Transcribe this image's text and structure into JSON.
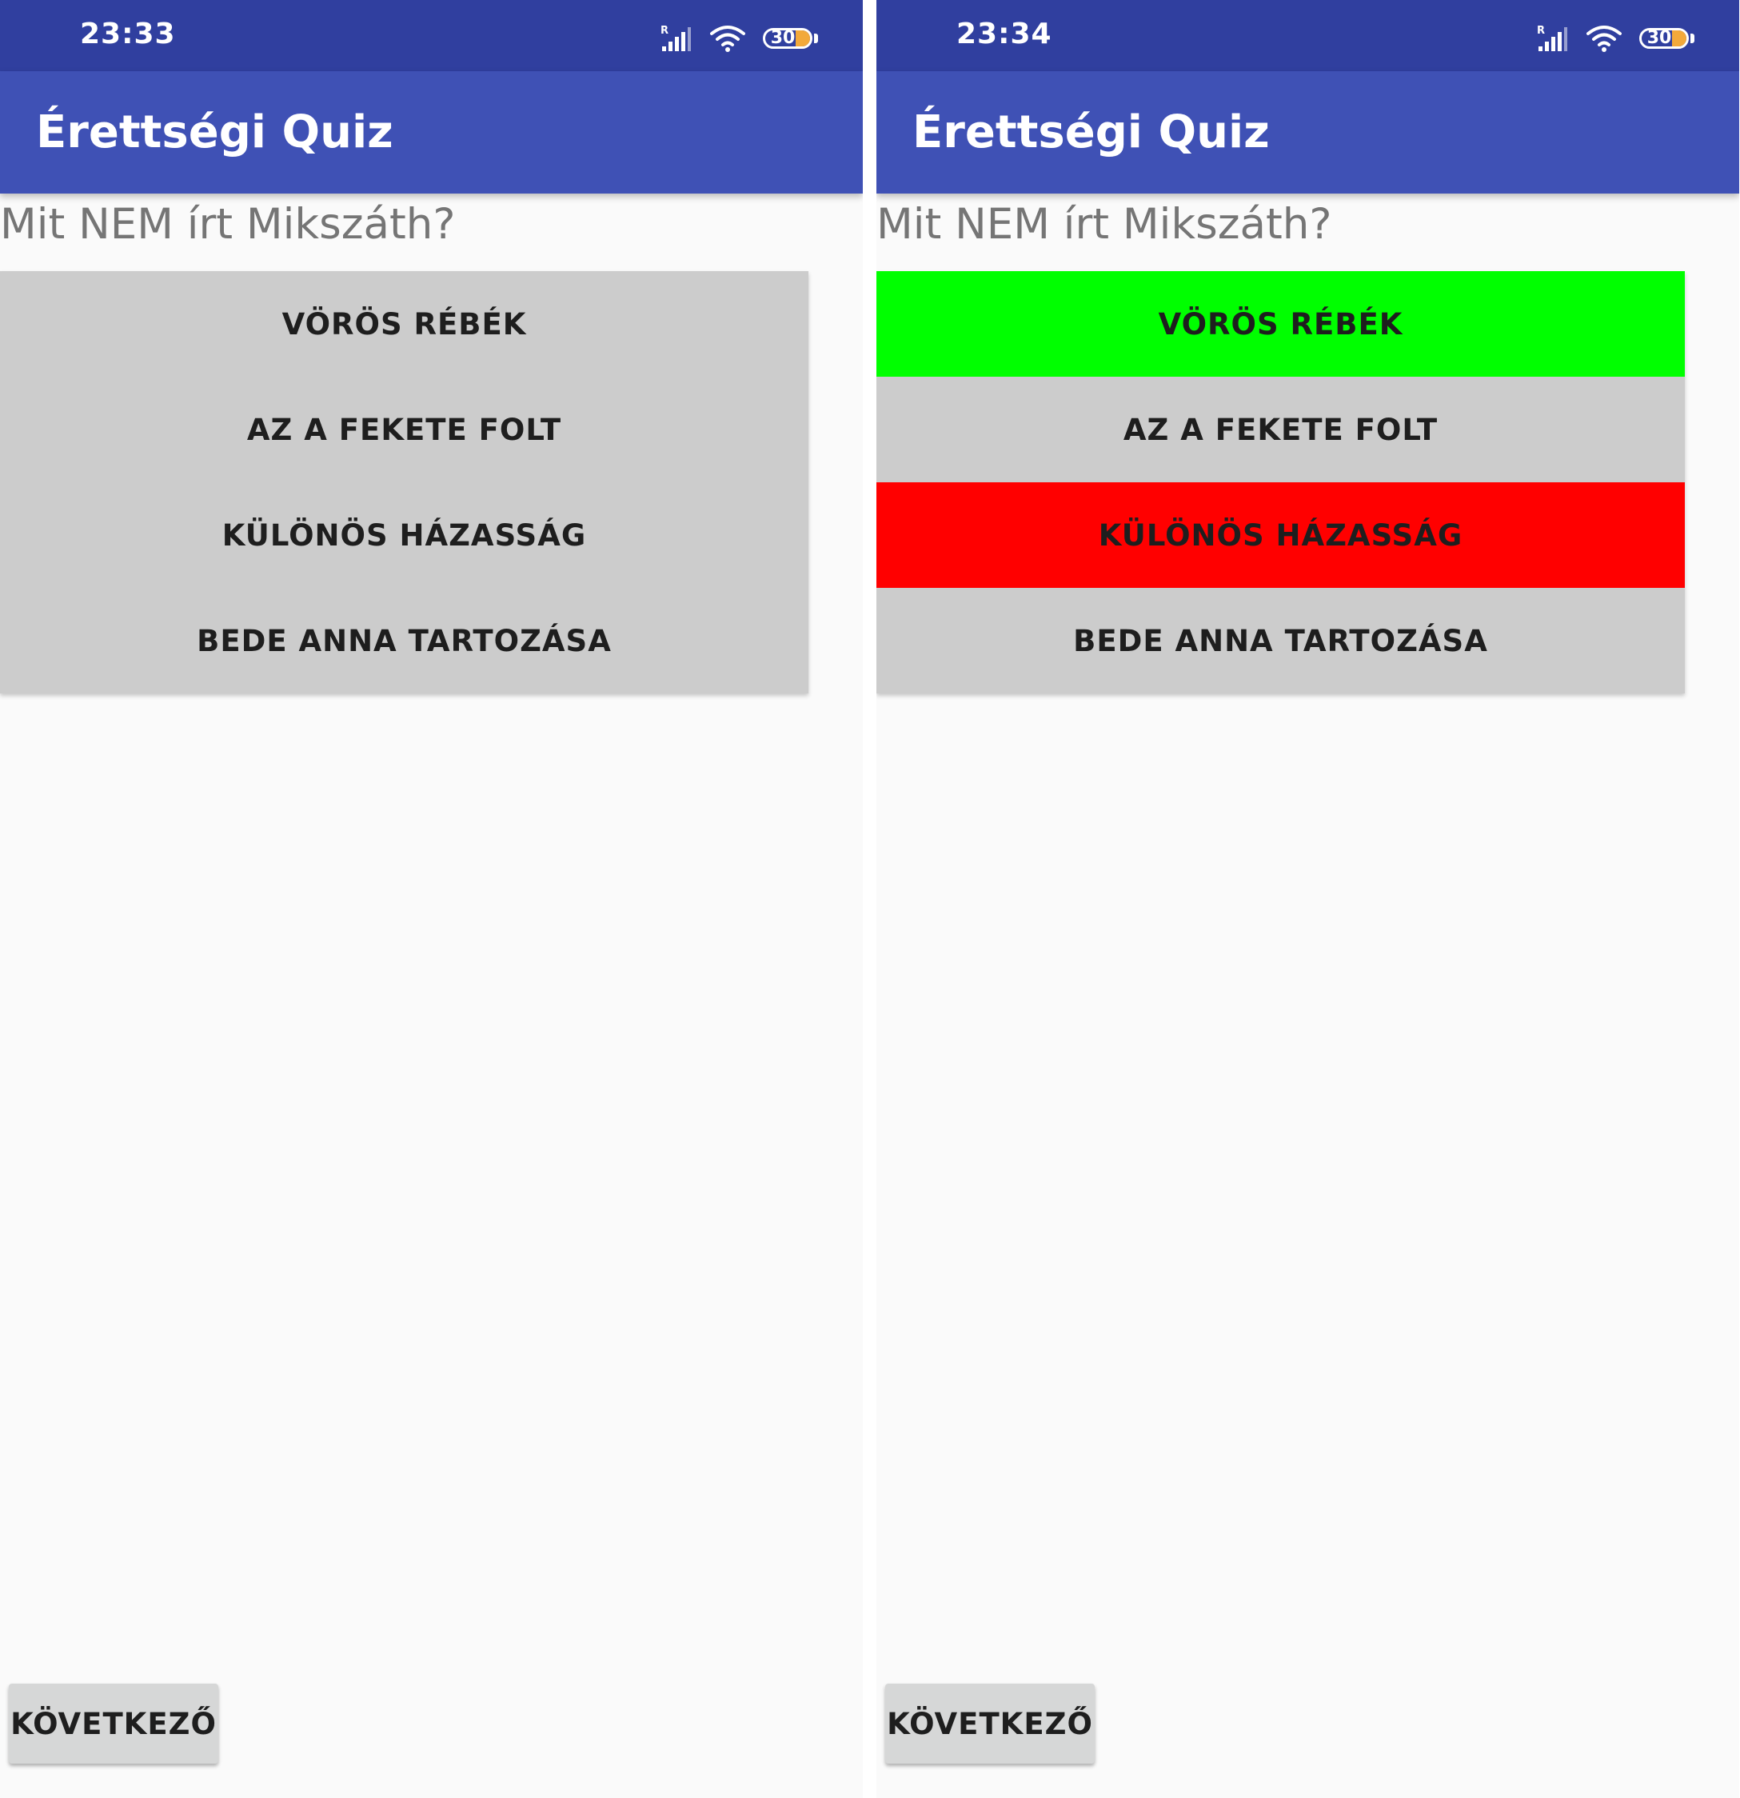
{
  "colors": {
    "status_bar": "#303f9f",
    "app_bar": "#3f51b5",
    "answer_default": "#cccccc",
    "answer_correct": "#00ff00",
    "answer_wrong": "#ff0000",
    "next_button": "#d6d7d7"
  },
  "screens": [
    {
      "status": {
        "time": "23:33",
        "signal_badge": "R",
        "battery_level": "30",
        "icons": [
          "signal-icon",
          "wifi-icon",
          "battery-icon"
        ]
      },
      "app_title": "Érettségi Quiz",
      "question": "Mit NEM írt Mikszáth?",
      "answers": [
        {
          "label": "VÖRÖS RÉBÉK",
          "state": "default"
        },
        {
          "label": "AZ A FEKETE FOLT",
          "state": "default"
        },
        {
          "label": "KÜLÖNÖS HÁZASSÁG",
          "state": "default"
        },
        {
          "label": "BEDE ANNA TARTOZÁSA",
          "state": "default"
        }
      ],
      "next_label": "KÖVETKEZŐ"
    },
    {
      "status": {
        "time": "23:34",
        "signal_badge": "R",
        "battery_level": "30",
        "icons": [
          "signal-icon",
          "wifi-icon",
          "battery-icon"
        ]
      },
      "app_title": "Érettségi Quiz",
      "question": "Mit NEM írt Mikszáth?",
      "answers": [
        {
          "label": "VÖRÖS RÉBÉK",
          "state": "correct"
        },
        {
          "label": "AZ A FEKETE FOLT",
          "state": "default"
        },
        {
          "label": "KÜLÖNÖS HÁZASSÁG",
          "state": "wrong"
        },
        {
          "label": "BEDE ANNA TARTOZÁSA",
          "state": "default"
        }
      ],
      "next_label": "KÖVETKEZŐ"
    }
  ]
}
